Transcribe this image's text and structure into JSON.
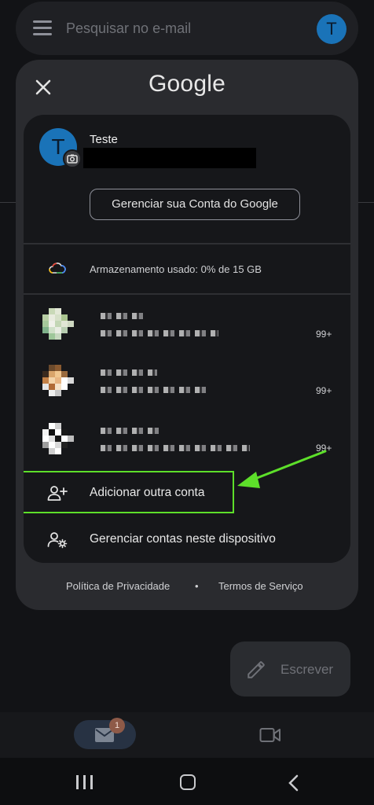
{
  "header": {
    "search_placeholder": "Pesquisar no e-mail",
    "avatar_letter": "T"
  },
  "sheet": {
    "logo_text": "Google",
    "account": {
      "avatar_letter": "T",
      "name": "Teste",
      "manage_label": "Gerenciar sua Conta do Google"
    },
    "storage_label": "Armazenamento usado: 0% de 15 GB",
    "other_accounts": [
      {
        "count": "99+"
      },
      {
        "count": "99+"
      },
      {
        "count": "99+"
      }
    ],
    "add_account_label": "Adicionar outra conta",
    "manage_devices_label": "Gerenciar contas neste dispositivo",
    "footer": {
      "privacy": "Política de Privacidade",
      "dot": "•",
      "terms": "Termos de Serviço"
    }
  },
  "compose": {
    "label": "Escrever"
  },
  "bottom_nav": {
    "mail_badge": "1"
  },
  "colors": {
    "highlight": "#5ddf2a",
    "avatar": "#1a73b8",
    "sheet_bg": "#2a2b2f",
    "card_bg": "#16171a"
  }
}
